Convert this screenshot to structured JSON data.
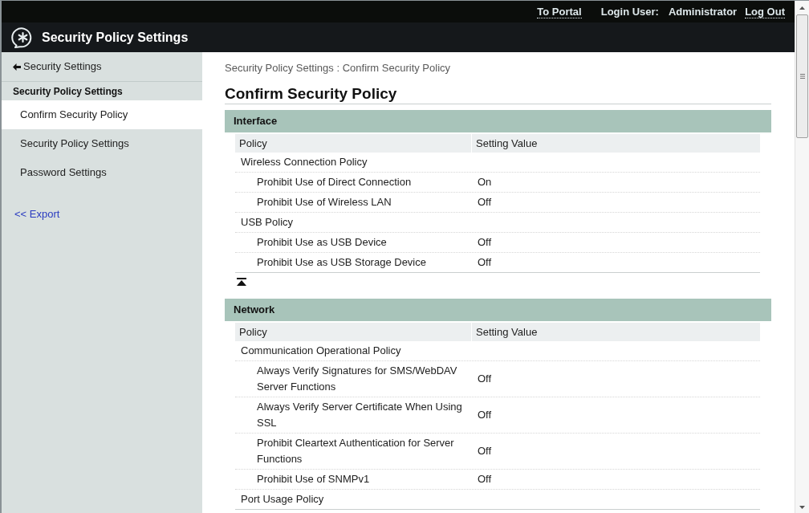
{
  "top_bar": {
    "portal_link": "To Portal",
    "login_label": "Login User:",
    "user": "Administrator",
    "logout_link": "Log Out"
  },
  "header": {
    "title": "Security Policy Settings"
  },
  "sidebar": {
    "back_link": "Security Settings",
    "section_title": "Security Policy Settings",
    "items": [
      {
        "label": "Confirm Security Policy",
        "selected": true
      },
      {
        "label": "Security Policy Settings",
        "selected": false
      },
      {
        "label": "Password Settings",
        "selected": false
      }
    ],
    "export_link": "<< Export"
  },
  "breadcrumb": "Security Policy Settings : Confirm Security Policy",
  "page_title": "Confirm Security Policy",
  "sections": [
    {
      "title": "Interface",
      "columns": [
        "Policy",
        "Setting Value"
      ],
      "rows": [
        {
          "label": "Wireless Connection Policy",
          "children": [
            {
              "label": "Prohibit Use of Direct Connection",
              "value": "On"
            },
            {
              "label": "Prohibit Use of Wireless LAN",
              "value": "Off"
            }
          ]
        },
        {
          "label": "USB Policy",
          "children": [
            {
              "label": "Prohibit Use as USB Device",
              "value": "Off"
            },
            {
              "label": "Prohibit Use as USB Storage Device",
              "value": "Off"
            }
          ]
        }
      ],
      "top_link": true
    },
    {
      "title": "Network",
      "columns": [
        "Policy",
        "Setting Value"
      ],
      "rows": [
        {
          "label": "Communication Operational Policy",
          "children": [
            {
              "label": "Always Verify Signatures for SMS/WebDAV Server Functions",
              "value": "Off"
            },
            {
              "label": "Always Verify Server Certificate When Using SSL",
              "value": "Off"
            },
            {
              "label": "Prohibit Cleartext Authentication for Server Functions",
              "value": "Off"
            },
            {
              "label": "Prohibit Use of SNMPv1",
              "value": "Off"
            }
          ]
        },
        {
          "label": "Port Usage Policy"
        }
      ]
    }
  ]
}
